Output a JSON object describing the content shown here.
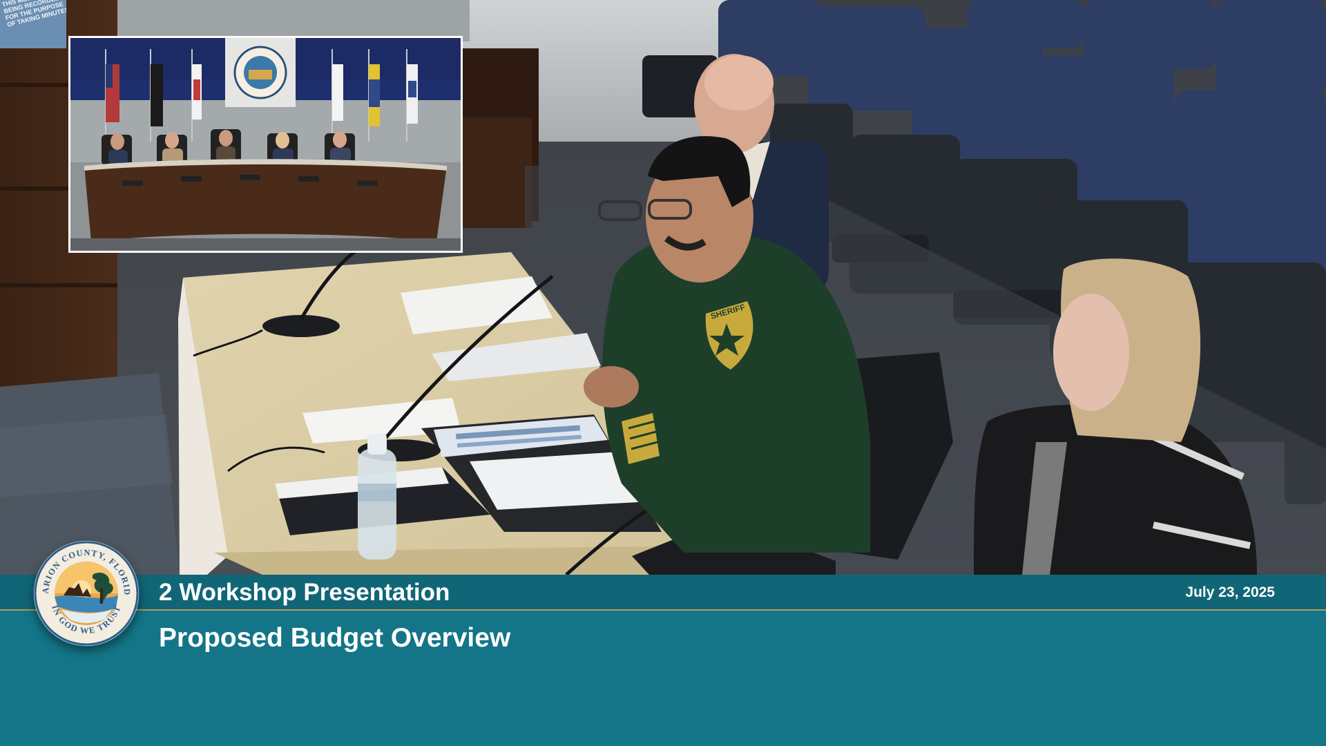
{
  "lower_third": {
    "segment_title": "2 Workshop Presentation",
    "segment_subtitle": "Proposed Budget Overview",
    "date": "July 23, 2025",
    "colors": {
      "band_dark": "#106676",
      "band_main": "#137587",
      "rule_gold": "#b69a59"
    }
  },
  "seal": {
    "icon": "marion-county-seal-icon",
    "ring_text_top": "MARION COUNTY, FLORIDA",
    "ring_text_bottom": "IN GOD WE TRUST"
  },
  "sign": {
    "text": "THIS MEETING IS\nBEING RECORDED\nFOR THE PURPOSE\nOF TAKING MINUTES"
  },
  "pip": {
    "description_icon": "commission-dais-camera-icon"
  },
  "scene": {
    "icon": "presenter-table-camera-icon",
    "officer_patch_text": "SHERIFF"
  }
}
